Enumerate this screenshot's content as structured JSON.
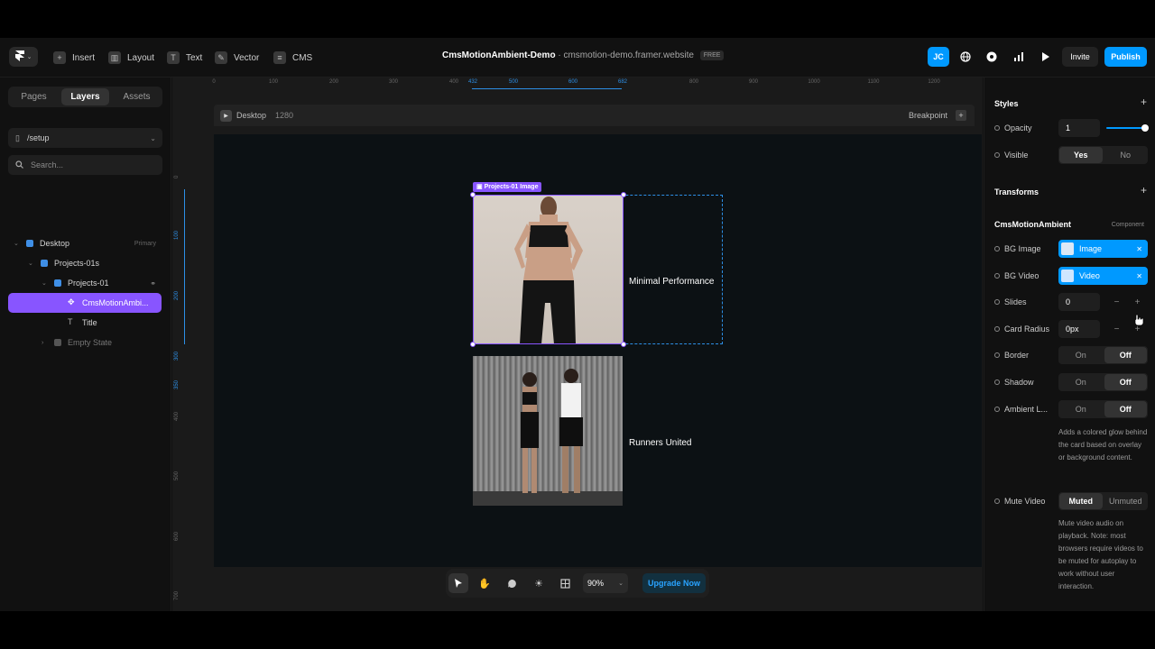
{
  "topbar": {
    "menu": [
      {
        "label": "Insert",
        "icon": "plus-square-icon"
      },
      {
        "label": "Layout",
        "icon": "layout-icon"
      },
      {
        "label": "Text",
        "icon": "text-icon"
      },
      {
        "label": "Vector",
        "icon": "pen-icon"
      },
      {
        "label": "CMS",
        "icon": "database-icon"
      }
    ],
    "project_name": "CmsMotionAmbient-Demo",
    "separator": "·",
    "domain": "cmsmotion-demo.framer.website",
    "plan_badge": "FREE",
    "avatar_initials": "JC",
    "invite_label": "Invite",
    "publish_label": "Publish"
  },
  "left_panel": {
    "tabs": [
      "Pages",
      "Layers",
      "Assets"
    ],
    "active_tab": "Layers",
    "page": "/setup",
    "search_placeholder": "Search...",
    "layers": [
      {
        "label": "Desktop",
        "right": "Primary"
      },
      {
        "label": "Projects-01s"
      },
      {
        "label": "Projects-01"
      },
      {
        "label": "CmsMotionAmbi..."
      },
      {
        "label": "Title",
        "icon_glyph": "T"
      },
      {
        "label": "Empty State"
      }
    ]
  },
  "canvas": {
    "ruler_top": [
      "0",
      "100",
      "200",
      "300",
      "400",
      "432",
      "500",
      "600",
      "682",
      "800",
      "900",
      "1000",
      "1100",
      "1200"
    ],
    "ruler_left": [
      "0",
      "100",
      "200",
      "300",
      "350",
      "400",
      "500",
      "600",
      "700"
    ],
    "frame_name": "Desktop",
    "frame_width": "1280",
    "breakpoint_label": "Breakpoint",
    "component_tag": "Projects-01 Image",
    "cards": [
      {
        "title": "Minimal Performance"
      },
      {
        "title": "Runners United"
      }
    ]
  },
  "bottom_toolbar": {
    "zoom": "90%",
    "upgrade_label": "Upgrade Now"
  },
  "right_panel": {
    "styles_title": "Styles",
    "opacity_label": "Opacity",
    "opacity_value": "1",
    "visible_label": "Visible",
    "yes": "Yes",
    "no": "No",
    "transforms_title": "Transforms",
    "component_name": "CmsMotionAmbient",
    "component_kind": "Component",
    "bg_image_label": "BG Image",
    "bg_image_value": "Image",
    "bg_video_label": "BG Video",
    "bg_video_value": "Video",
    "slides_label": "Slides",
    "slides_value": "0",
    "card_radius_label": "Card Radius",
    "card_radius_value": "0px",
    "border_label": "Border",
    "shadow_label": "Shadow",
    "ambient_label": "Ambient L...",
    "on": "On",
    "off": "Off",
    "ambient_desc": "Adds a colored glow behind the card based on overlay or background content.",
    "mute_label": "Mute Video",
    "muted": "Muted",
    "unmuted": "Unmuted",
    "mute_desc": "Mute video audio on playback. Note: most browsers require videos to be muted for autoplay to work without user interaction."
  },
  "colors": {
    "accent_blue": "#0099ff",
    "selection_purple": "#8855ff",
    "canvas_bg": "#0c1114"
  }
}
